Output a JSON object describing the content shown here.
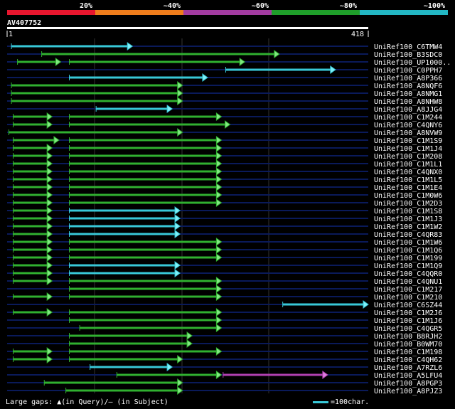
{
  "identity_scale": {
    "labels": [
      "20%",
      "~40%",
      "~60%",
      "~80%",
      "~100%"
    ],
    "colors": [
      "#e8162e",
      "#ef7d1c",
      "#a23ba0",
      "#1f9e2a",
      "#23b7c4"
    ]
  },
  "query": {
    "id": "AV407752",
    "start_label": "1",
    "end_label": "418",
    "length": 418
  },
  "colors": {
    "green": "#30b030",
    "cyan": "#38c8d8",
    "magenta": "#b040b0",
    "track": "#0a1a5a",
    "grid": "#333333",
    "arrow_fill_green": "#80e880",
    "arrow_fill_cyan": "#80f0f8",
    "arrow_fill_magenta": "#e080e0"
  },
  "hits": [
    {
      "name": "UniRef100_C6TMW4",
      "segs": [
        [
          5,
          145,
          "c"
        ]
      ]
    },
    {
      "name": "UniRef100_B3SDC0",
      "segs": [
        [
          40,
          315,
          "g"
        ]
      ]
    },
    {
      "name": "UniRef100_UP1000..",
      "segs": [
        [
          12,
          62,
          "g"
        ],
        [
          72,
          275,
          "g"
        ]
      ]
    },
    {
      "name": "UniRef100_C0PPH7",
      "segs": [
        [
          253,
          380,
          "c"
        ]
      ]
    },
    {
      "name": "UniRef100_A8P366",
      "segs": [
        [
          72,
          232,
          "c"
        ]
      ]
    },
    {
      "name": "UniRef100_A8NQF6",
      "segs": [
        [
          5,
          203,
          "g"
        ]
      ]
    },
    {
      "name": "UniRef100_A8NMG1",
      "segs": [
        [
          5,
          203,
          "g"
        ]
      ]
    },
    {
      "name": "UniRef100_A8NHW8",
      "segs": [
        [
          5,
          203,
          "g"
        ]
      ]
    },
    {
      "name": "UniRef100_A8JJG4",
      "segs": [
        [
          103,
          191,
          "c"
        ]
      ]
    },
    {
      "name": "UniRef100_C1M244",
      "segs": [
        [
          7,
          52,
          "g"
        ],
        [
          72,
          248,
          "g"
        ]
      ]
    },
    {
      "name": "UniRef100_C4QNY6",
      "segs": [
        [
          7,
          52,
          "g"
        ],
        [
          72,
          258,
          "g"
        ]
      ]
    },
    {
      "name": "UniRef100_A8NVW9",
      "segs": [
        [
          2,
          203,
          "g"
        ]
      ]
    },
    {
      "name": "UniRef100_C1M1S9",
      "segs": [
        [
          7,
          60,
          "g"
        ],
        [
          72,
          248,
          "g"
        ]
      ]
    },
    {
      "name": "UniRef100_C1M1J4",
      "segs": [
        [
          7,
          52,
          "g"
        ],
        [
          72,
          248,
          "g"
        ]
      ]
    },
    {
      "name": "UniRef100_C1M208",
      "segs": [
        [
          7,
          52,
          "g"
        ],
        [
          72,
          248,
          "g"
        ]
      ]
    },
    {
      "name": "UniRef100_C1M1L1",
      "segs": [
        [
          7,
          52,
          "g"
        ],
        [
          72,
          248,
          "g"
        ]
      ]
    },
    {
      "name": "UniRef100_C4QNX0",
      "segs": [
        [
          7,
          52,
          "g"
        ],
        [
          72,
          248,
          "g"
        ]
      ]
    },
    {
      "name": "UniRef100_C1M1L5",
      "segs": [
        [
          7,
          52,
          "g"
        ],
        [
          72,
          248,
          "g"
        ]
      ]
    },
    {
      "name": "UniRef100_C1M1E4",
      "segs": [
        [
          7,
          52,
          "g"
        ],
        [
          72,
          248,
          "g"
        ]
      ]
    },
    {
      "name": "UniRef100_C1M0W6",
      "segs": [
        [
          7,
          52,
          "g"
        ],
        [
          72,
          248,
          "g"
        ]
      ]
    },
    {
      "name": "UniRef100_C1M2D3",
      "segs": [
        [
          7,
          52,
          "g"
        ],
        [
          72,
          248,
          "g"
        ]
      ]
    },
    {
      "name": "UniRef100_C1M1S8",
      "segs": [
        [
          7,
          52,
          "g"
        ],
        [
          72,
          200,
          "c"
        ]
      ]
    },
    {
      "name": "UniRef100_C1M1J3",
      "segs": [
        [
          7,
          52,
          "g"
        ],
        [
          72,
          200,
          "c"
        ]
      ]
    },
    {
      "name": "UniRef100_C1M1W2",
      "segs": [
        [
          7,
          52,
          "g"
        ],
        [
          72,
          200,
          "c"
        ]
      ]
    },
    {
      "name": "UniRef100_C4QR83",
      "segs": [
        [
          7,
          52,
          "g"
        ],
        [
          72,
          200,
          "c"
        ]
      ]
    },
    {
      "name": "UniRef100_C1M1W6",
      "segs": [
        [
          7,
          52,
          "g"
        ],
        [
          72,
          248,
          "g"
        ]
      ]
    },
    {
      "name": "UniRef100_C1M1Q6",
      "segs": [
        [
          7,
          52,
          "g"
        ],
        [
          72,
          248,
          "g"
        ]
      ]
    },
    {
      "name": "UniRef100_C1M199",
      "segs": [
        [
          7,
          52,
          "g"
        ],
        [
          72,
          248,
          "g"
        ]
      ]
    },
    {
      "name": "UniRef100_C1M1Q9",
      "segs": [
        [
          7,
          52,
          "g"
        ],
        [
          72,
          200,
          "c"
        ]
      ]
    },
    {
      "name": "UniRef100_C4QQR0",
      "segs": [
        [
          7,
          52,
          "g"
        ],
        [
          72,
          200,
          "c"
        ]
      ]
    },
    {
      "name": "UniRef100_C4QNU1",
      "segs": [
        [
          7,
          52,
          "g"
        ],
        [
          72,
          248,
          "g"
        ]
      ]
    },
    {
      "name": "UniRef100_C1M217",
      "segs": [
        [
          72,
          248,
          "g"
        ]
      ]
    },
    {
      "name": "UniRef100_C1M210",
      "segs": [
        [
          7,
          52,
          "g"
        ],
        [
          72,
          248,
          "g"
        ]
      ]
    },
    {
      "name": "UniRef100_C6SZ44",
      "segs": [
        [
          319,
          418,
          "c"
        ]
      ]
    },
    {
      "name": "UniRef100_C1M2J6",
      "segs": [
        [
          7,
          52,
          "g"
        ],
        [
          72,
          248,
          "g"
        ]
      ]
    },
    {
      "name": "UniRef100_C1M1J6",
      "segs": [
        [
          72,
          248,
          "g"
        ]
      ]
    },
    {
      "name": "UniRef100_C4QGR5",
      "segs": [
        [
          84,
          248,
          "g"
        ]
      ]
    },
    {
      "name": "UniRef100_B8RJH2",
      "segs": [
        [
          72,
          214,
          "g"
        ]
      ]
    },
    {
      "name": "UniRef100_B0WM70",
      "segs": [
        [
          72,
          214,
          "g"
        ]
      ]
    },
    {
      "name": "UniRef100_C1M198",
      "segs": [
        [
          7,
          52,
          "g"
        ],
        [
          72,
          248,
          "g"
        ]
      ]
    },
    {
      "name": "UniRef100_C4QH62",
      "segs": [
        [
          7,
          52,
          "g"
        ],
        [
          72,
          203,
          "g"
        ]
      ]
    },
    {
      "name": "UniRef100_A7RZL6",
      "segs": [
        [
          96,
          191,
          "c"
        ]
      ]
    },
    {
      "name": "UniRef100_A5LFU4",
      "segs": [
        [
          127,
          248,
          "g"
        ],
        [
          250,
          371,
          "m"
        ]
      ]
    },
    {
      "name": "UniRef100_A8PGP3",
      "segs": [
        [
          43,
          203,
          "g"
        ]
      ]
    },
    {
      "name": "UniRef100_A8PJZ3",
      "segs": [
        [
          68,
          203,
          "g"
        ]
      ]
    }
  ],
  "footer": {
    "gaps_label": "Large gaps: ▲(in Query)/– (in Subject)",
    "legend_label": "=100char."
  }
}
